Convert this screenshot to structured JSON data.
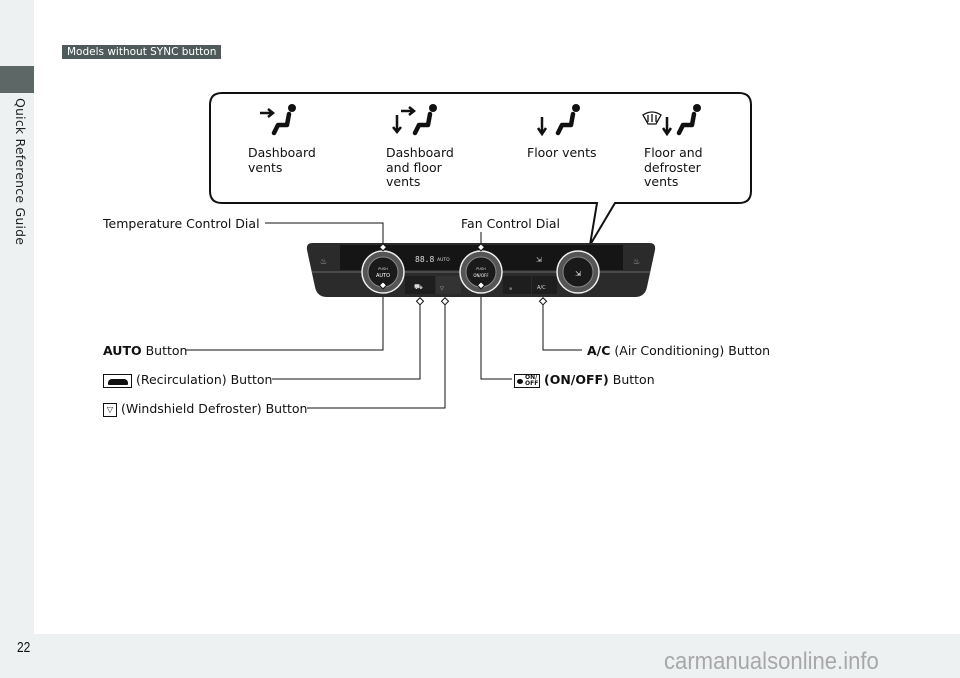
{
  "sidebar": {
    "section_title": "Quick Reference Guide"
  },
  "tag": "Models without SYNC button",
  "vent_modes": [
    {
      "icon": "dashboard-vents-icon",
      "label": "Dashboard vents"
    },
    {
      "icon": "dashboard-and-floor-vents-icon",
      "label": "Dashboard and floor vents"
    },
    {
      "icon": "floor-vents-icon",
      "label": "Floor vents"
    },
    {
      "icon": "floor-and-defroster-vents-icon",
      "label": "Floor and defroster vents"
    }
  ],
  "callouts": {
    "temperature_dial": "Temperature Control Dial",
    "fan_dial": "Fan Control Dial",
    "auto_bold": "AUTO",
    "auto_rest": " Button",
    "recirculation": "(Recirculation) Button",
    "defroster": "(Windshield Defroster) Button",
    "ac_bold": "A/C",
    "ac_rest": " (Air Conditioning) Button",
    "onoff_bold": "(ON/OFF)",
    "onoff_rest": " Button"
  },
  "panel": {
    "temp_display": "88.8",
    "auto_indicator": "AUTO",
    "left_dial_push": "PUSH",
    "left_dial_label": "AUTO",
    "center_dial_push": "PUSH",
    "center_dial_label": "ON/OFF",
    "ac_button": "A/C"
  },
  "footer": {
    "page_number": "22",
    "watermark": "carmanualsonline.info"
  },
  "colors": {
    "tag_bg": "#4f5b5a",
    "sidebar_bg": "#eef1f2",
    "panel_dark": "#2a2a2a"
  }
}
